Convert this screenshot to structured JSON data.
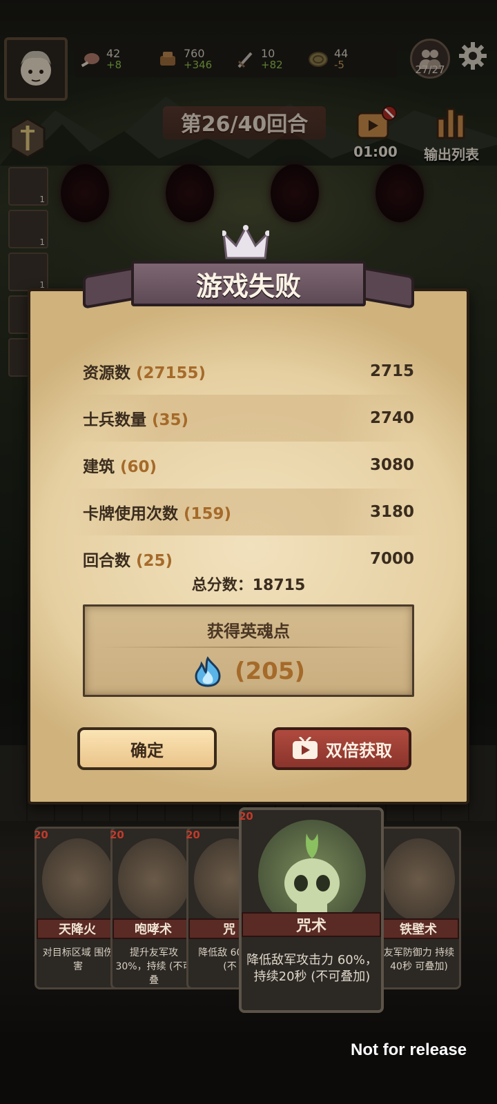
{
  "topbar": {
    "resources": [
      {
        "icon": "meat-icon",
        "value": "42",
        "delta": "+8",
        "delta_sign": "pos"
      },
      {
        "icon": "wood-icon",
        "value": "760",
        "delta": "+346",
        "delta_sign": "pos"
      },
      {
        "icon": "sword-icon",
        "value": "10",
        "delta": "+82",
        "delta_sign": "pos"
      },
      {
        "icon": "coin-icon",
        "value": "44",
        "delta": "-5",
        "delta_sign": "neg"
      }
    ],
    "army_count": "27/27"
  },
  "round": {
    "label": "第26/40回合"
  },
  "ad_timer": {
    "label": "01:00"
  },
  "output_list": {
    "label": "输出列表"
  },
  "side_slots": [
    "1",
    "1",
    "1"
  ],
  "modal": {
    "title": "游戏失败",
    "rows": [
      {
        "label": "资源数",
        "count": "(27155)",
        "points": "2715"
      },
      {
        "label": "士兵数量",
        "count": "(35)",
        "points": "2740"
      },
      {
        "label": "建筑",
        "count": "(60)",
        "points": "3080"
      },
      {
        "label": "卡牌使用次数",
        "count": "(159)",
        "points": "3180"
      },
      {
        "label": "回合数",
        "count": "(25)",
        "points": "7000"
      }
    ],
    "total": "总分数：18715",
    "soul_header": "获得英魂点",
    "soul_value": "(205)",
    "confirm_label": "确定",
    "double_label": "双倍获取"
  },
  "cards": [
    {
      "level": "20",
      "name": "天降火",
      "desc": "对目标区域 围伤害"
    },
    {
      "level": "20",
      "name": "咆哮术",
      "desc": "提升友军攻 30%，持续 (不可叠"
    },
    {
      "level": "20",
      "name": "咒",
      "desc": "降低敌 60%， (不"
    },
    {
      "level": "20",
      "name": "咒术",
      "desc": "降低敌军攻击力 60%，持续20秒 (不可叠加)"
    },
    {
      "level": "",
      "name": "铁壁术",
      "desc": "友军防御力 持续40秒 可叠加)"
    }
  ],
  "watermark": "Not for release",
  "colors": {
    "parchment": "#e6d0a2",
    "accent_text": "#a56a2a",
    "confirm_button": "#eac48a",
    "double_button": "#8a342c",
    "title_ribbon": "#6d5862"
  }
}
